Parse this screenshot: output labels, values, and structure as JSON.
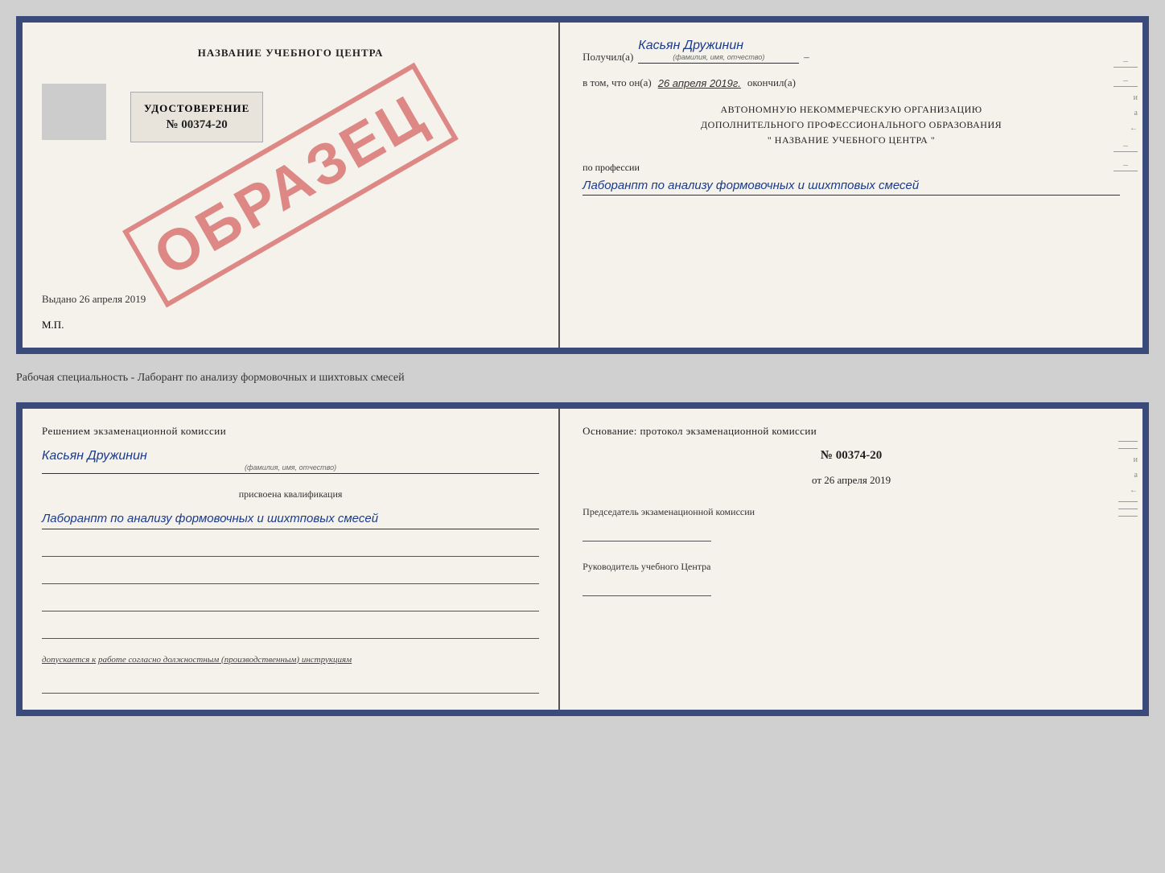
{
  "top_cert": {
    "left": {
      "school_name": "НАЗВАНИЕ УЧЕБНОГО ЦЕНТРА",
      "cert_label": "УДОСТОВЕРЕНИЕ",
      "cert_number": "№ 00374-20",
      "issued_label": "Выдано",
      "issued_date": "26 апреля 2019",
      "mp_label": "М.П.",
      "obrazec": "ОБРАЗЕЦ"
    },
    "right": {
      "received_label": "Получил(а)",
      "received_name": "Касьян Дружинин",
      "name_hint": "(фамилия, имя, отчество)",
      "date_prefix": "в том, что он(а)",
      "date_value": "26 апреля 2019г.",
      "okoncil": "окончил(а)",
      "org_line1": "АВТОНОМНУЮ НЕКОММЕРЧЕСКУЮ ОРГАНИЗАЦИЮ",
      "org_line2": "ДОПОЛНИТЕЛЬНОГО ПРОФЕССИОНАЛЬНОГО ОБРАЗОВАНИЯ",
      "org_quote1": "\"",
      "org_name": "НАЗВАНИЕ УЧЕБНОГО ЦЕНТРА",
      "org_quote2": "\"",
      "profession_label": "по профессии",
      "profession_value": "Лаборанпт по анализу формовочных и шихтповых смесей"
    }
  },
  "specialty_line": "Рабочая специальность - Лаборант по анализу формовочных и шихтовых смесей",
  "bottom_cert": {
    "left": {
      "section_title": "Решением экзаменационной комиссии",
      "name_value": "Касьян Дружинин",
      "name_hint": "(фамилия, имя, отчество)",
      "qualification_label": "присвоена квалификация",
      "qualification_value": "Лаборанпт по анализу формовочных и шихтповых смесей",
      "допускается_prefix": "допускается к",
      "допускается_text": "работе согласно должностным (производственным) инструкциям"
    },
    "right": {
      "osnov_title": "Основание: протокол экзаменационной комиссии",
      "protocol_number": "№ 00374-20",
      "protocol_date_prefix": "от",
      "protocol_date": "26 апреля 2019",
      "chairman_label": "Председатель экзаменационной комиссии",
      "руководитель_label": "Руководитель учебного Центра"
    }
  }
}
